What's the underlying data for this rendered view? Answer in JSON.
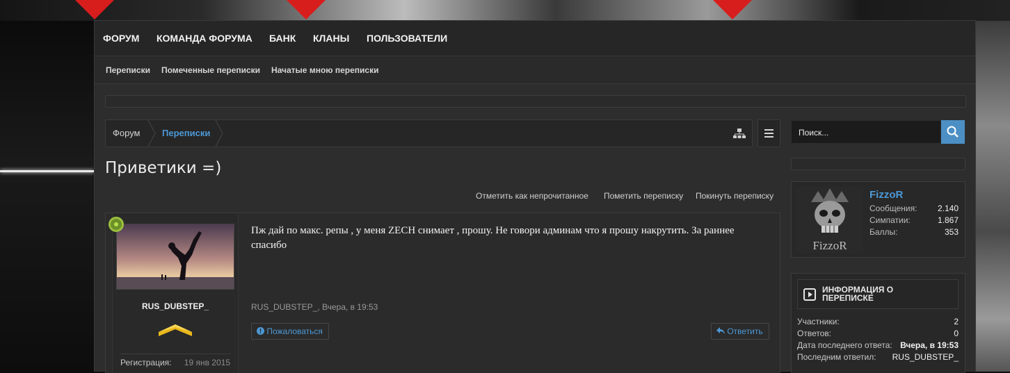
{
  "nav": {
    "items": [
      "ФОРУМ",
      "КОМАНДА ФОРУМА",
      "БАНК",
      "КЛАНЫ",
      "ПОЛЬЗОВАТЕЛИ"
    ]
  },
  "subnav": {
    "items": [
      "Переписки",
      "Помеченные переписки",
      "Начатые мною переписки"
    ]
  },
  "breadcrumb": {
    "items": [
      "Форум",
      "Переписки"
    ]
  },
  "page": {
    "title": "Приветики =)"
  },
  "actions": {
    "mark_unread": "Отметить как непрочитанное",
    "star": "Пометить переписку",
    "leave": "Покинуть переписку"
  },
  "post": {
    "username": "RUS_DUBSTEP_",
    "reg_label": "Регистрация:",
    "reg_value": "19 янв 2015",
    "message": "Пж дай по макс. репы , у меня ZECH снимает , прошу. Не говори админам что я прошу накрутить. За раннее спасибо",
    "meta": "RUS_DUBSTEP_, Вчера, в 19:53",
    "report_label": "Пожаловаться",
    "reply_label": "Ответить"
  },
  "search": {
    "placeholder": "Поиск..."
  },
  "profile": {
    "name": "FizzoR",
    "avatar_text": "FizzoR",
    "rows": [
      {
        "label": "Сообщения:",
        "value": "2.140"
      },
      {
        "label": "Симпатии:",
        "value": "1.867"
      },
      {
        "label": "Баллы:",
        "value": "353"
      }
    ]
  },
  "info": {
    "title": "ИНФОРМАЦИЯ О ПЕРЕПИСКЕ",
    "rows": [
      {
        "label": "Участники:",
        "value": "2"
      },
      {
        "label": "Ответов:",
        "value": "0"
      },
      {
        "label": "Дата последнего ответа:",
        "value": "Вчера, в 19:53"
      },
      {
        "label": "Последним ответил:",
        "value": "RUS_DUBSTEP_"
      }
    ]
  },
  "colors": {
    "accent": "#4c98d6",
    "search_button": "#4b8fc5",
    "online": "#9bbf3f",
    "header_red": "#d81d1d"
  }
}
